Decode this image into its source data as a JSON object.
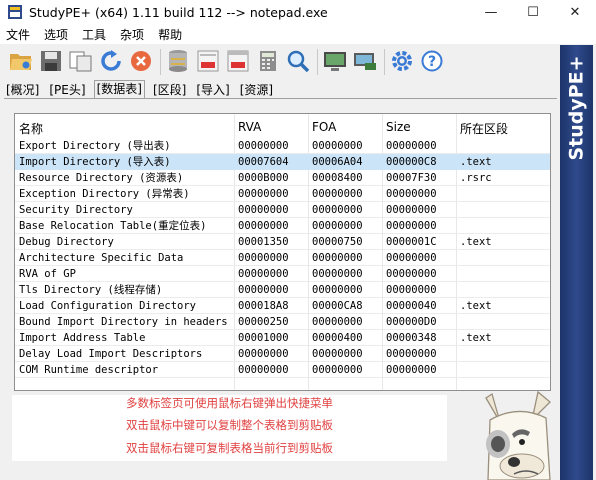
{
  "window": {
    "title": "StudyPE+ (x64) 1.11 build 112  --> notepad.exe",
    "minimize": "—",
    "maximize": "☐",
    "close": "✕"
  },
  "menu": [
    "文件",
    "选项",
    "工具",
    "杂项",
    "帮助"
  ],
  "toolbar": [
    "open-file-icon",
    "save-icon",
    "copy-icon",
    "reload-icon",
    "close-file-icon",
    "database-icon",
    "asm-doc-icon",
    "asm-window-icon",
    "calculator-icon",
    "search-icon",
    "monitor-icon",
    "network-icon",
    "settings-icon",
    "help-icon"
  ],
  "tabs": [
    {
      "label": "[概况]",
      "active": false
    },
    {
      "label": "[PE头]",
      "active": false
    },
    {
      "label": "[数据表]",
      "active": true
    },
    {
      "label": "[区段]",
      "active": false
    },
    {
      "label": "[导入]",
      "active": false
    },
    {
      "label": "[资源]",
      "active": false
    }
  ],
  "table": {
    "columns": [
      "名称",
      "RVA",
      "FOA",
      "Size",
      "所在区段"
    ],
    "rows": [
      {
        "name": "Export Directory        (导出表)",
        "rva": "00000000",
        "foa": "00000000",
        "size": "00000000",
        "section": ""
      },
      {
        "name": "Import Directory        (导入表)",
        "rva": "00007604",
        "foa": "00006A04",
        "size": "000000C8",
        "section": ".text",
        "selected": true
      },
      {
        "name": "Resource Directory      (资源表)",
        "rva": "0000B000",
        "foa": "00008400",
        "size": "00007F30",
        "section": ".rsrc"
      },
      {
        "name": "Exception Directory     (异常表)",
        "rva": "00000000",
        "foa": "00000000",
        "size": "00000000",
        "section": ""
      },
      {
        "name": "Security Directory",
        "rva": "00000000",
        "foa": "00000000",
        "size": "00000000",
        "section": ""
      },
      {
        "name": "Base Relocation Table(重定位表)",
        "rva": "00000000",
        "foa": "00000000",
        "size": "00000000",
        "section": ""
      },
      {
        "name": "Debug Directory",
        "rva": "00001350",
        "foa": "00000750",
        "size": "0000001C",
        "section": ".text"
      },
      {
        "name": "Architecture Specific Data",
        "rva": "00000000",
        "foa": "00000000",
        "size": "00000000",
        "section": ""
      },
      {
        "name": "RVA of GP",
        "rva": "00000000",
        "foa": "00000000",
        "size": "00000000",
        "section": ""
      },
      {
        "name": "Tls Directory          (线程存储)",
        "rva": "00000000",
        "foa": "00000000",
        "size": "00000000",
        "section": ""
      },
      {
        "name": "Load Configuration Directory",
        "rva": "000018A8",
        "foa": "00000CA8",
        "size": "00000040",
        "section": ".text"
      },
      {
        "name": "Bound Import Directory in headers",
        "rva": "00000250",
        "foa": "00000000",
        "size": "000000D0",
        "section": ""
      },
      {
        "name": "Import Address Table",
        "rva": "00001000",
        "foa": "00000400",
        "size": "00000348",
        "section": ".text"
      },
      {
        "name": "Delay Load Import Descriptors",
        "rva": "00000000",
        "foa": "00000000",
        "size": "00000000",
        "section": ""
      },
      {
        "name": "COM Runtime descriptor",
        "rva": "00000000",
        "foa": "00000000",
        "size": "00000000",
        "section": ""
      }
    ]
  },
  "notes": [
    "多数标签页可使用鼠标右键弹出快捷菜单",
    "双击鼠标中键可以复制整个表格到剪贴板",
    "双击鼠标右键可复制表格当前行到剪贴板"
  ],
  "brand": "StudyPE+",
  "colors": {
    "selection": "#cce4f7",
    "note_text": "#e04040",
    "side_panel": "#2f4a8c"
  }
}
